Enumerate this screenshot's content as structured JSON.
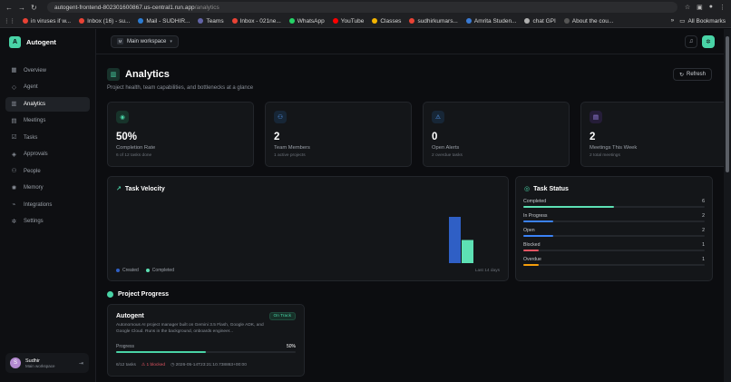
{
  "browser": {
    "url_host": "autogent-frontend-802301600867.us-central1.run.app",
    "url_path": "/analytics",
    "bookmarks": [
      {
        "label": "in viruses if w...",
        "icon": "google-icon",
        "color": "#e94235"
      },
      {
        "label": "Inbox (16) - su...",
        "icon": "gmail-icon",
        "color": "#ea4335"
      },
      {
        "label": "Mail - SUDHIR...",
        "icon": "outlook-icon",
        "color": "#2b7cd3"
      },
      {
        "label": "Teams",
        "icon": "teams-icon",
        "color": "#6264a7"
      },
      {
        "label": "Inbox - 021ne...",
        "icon": "gmail-icon",
        "color": "#ea4335"
      },
      {
        "label": "WhatsApp",
        "icon": "whatsapp-icon",
        "color": "#25d366"
      },
      {
        "label": "YouTube",
        "icon": "youtube-icon",
        "color": "#ff0000"
      },
      {
        "label": "Classes",
        "icon": "classroom-icon",
        "color": "#f4b400"
      },
      {
        "label": "sudhirkumars...",
        "icon": "gmail-icon",
        "color": "#ea4335"
      },
      {
        "label": "Amrita Studen...",
        "icon": "amrita-icon",
        "color": "#3a7bd5"
      },
      {
        "label": "chat GPI",
        "icon": "chatgpt-icon",
        "color": "#b0b0b0"
      },
      {
        "label": "About the cou...",
        "icon": "page-icon",
        "color": "#555555"
      }
    ],
    "all_bookmarks": "All Bookmarks"
  },
  "brand": {
    "logo_letter": "A",
    "name": "Autogent"
  },
  "sidebar": {
    "items": [
      {
        "label": "Overview",
        "icon": "grid-icon"
      },
      {
        "label": "Agent",
        "icon": "bot-icon"
      },
      {
        "label": "Analytics",
        "icon": "chart-icon",
        "active": true
      },
      {
        "label": "Meetings",
        "icon": "calendar-icon"
      },
      {
        "label": "Tasks",
        "icon": "checklist-icon"
      },
      {
        "label": "Approvals",
        "icon": "shield-check-icon"
      },
      {
        "label": "People",
        "icon": "users-icon"
      },
      {
        "label": "Memory",
        "icon": "brain-icon"
      },
      {
        "label": "Integrations",
        "icon": "plug-icon"
      },
      {
        "label": "Settings",
        "icon": "gear-icon"
      }
    ]
  },
  "user": {
    "initial": "S",
    "name": "Sudhir",
    "workspace": "Main workspace"
  },
  "topbar": {
    "workspace": "Main workspace"
  },
  "page": {
    "title": "Analytics",
    "subtitle": "Project health, team capabilities, and bottlenecks at a glance",
    "refresh": "Refresh"
  },
  "stats": [
    {
      "value": "50%",
      "label": "Completion Rate",
      "sub": "6 of 12 tasks done",
      "icon": "target-icon",
      "icon_bg": "#17332a",
      "icon_color": "#49d3a6"
    },
    {
      "value": "2",
      "label": "Team Members",
      "sub": "1 active projects",
      "icon": "users-icon",
      "icon_bg": "#172636",
      "icon_color": "#5aa1ff"
    },
    {
      "value": "0",
      "label": "Open Alerts",
      "sub": "2 overdue tasks",
      "icon": "alert-triangle-icon",
      "icon_bg": "#172636",
      "icon_color": "#5aa1ff"
    },
    {
      "value": "2",
      "label": "Meetings This Week",
      "sub": "2 total meetings",
      "icon": "calendar-icon",
      "icon_bg": "#251d38",
      "icon_color": "#a48bf2"
    }
  ],
  "velocity": {
    "title": "Task Velocity",
    "legend_created": "Created",
    "legend_completed": "Completed",
    "range_label": "Last 14 days"
  },
  "chart_data": {
    "type": "bar",
    "categories": [
      "today"
    ],
    "series": [
      {
        "name": "Created",
        "values": [
          12
        ],
        "color": "#2f5fc5"
      },
      {
        "name": "Completed",
        "values": [
          6
        ],
        "color": "#5de0b4"
      }
    ],
    "title": "Task Velocity"
  },
  "task_status": {
    "title": "Task Status",
    "rows": [
      {
        "label": "Completed",
        "count": "6",
        "fraction": 0.5,
        "color": "#5de0b4"
      },
      {
        "label": "In Progress",
        "count": "2",
        "fraction": 0.167,
        "color": "#3b82f6"
      },
      {
        "label": "Open",
        "count": "2",
        "fraction": 0.167,
        "color": "#3b82f6"
      },
      {
        "label": "Blocked",
        "count": "1",
        "fraction": 0.083,
        "color": "#e25563"
      },
      {
        "label": "Overdue",
        "count": "1",
        "fraction": 0.083,
        "color": "#f59e0b"
      }
    ]
  },
  "projects": {
    "title": "Project Progress",
    "items": [
      {
        "name": "Autogent",
        "badge": "On Track",
        "description": "Autonomous AI project manager built on Gemini 3.5 Flash, Google ADK, and Google Cloud. Runs in the background, onboards engineer...",
        "progress_label": "Progress",
        "progress_text": "50%",
        "progress": 0.5,
        "tasks": "6/12 tasks",
        "blocked": "1 blocked",
        "timestamp": "2026-05-14T23:21:10.738863+00:00"
      }
    ]
  }
}
